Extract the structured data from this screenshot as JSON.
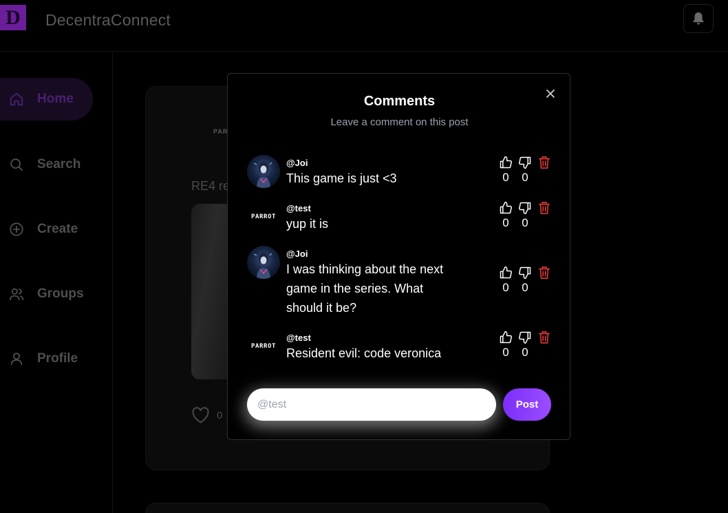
{
  "app": {
    "logo_letter": "D",
    "title": "DecentraConnect",
    "accent_color": "#7b2ff7"
  },
  "sidebar": {
    "items": [
      {
        "label": "Home",
        "icon": "home-icon",
        "active": true
      },
      {
        "label": "Search",
        "icon": "search-icon",
        "active": false
      },
      {
        "label": "Create",
        "icon": "plus-circle-icon",
        "active": false
      },
      {
        "label": "Groups",
        "icon": "users-icon",
        "active": false
      },
      {
        "label": "Profile",
        "icon": "user-icon",
        "active": false
      }
    ]
  },
  "feed": {
    "post_brand": "PARR",
    "post_title": "RE4 re",
    "like_count": "0"
  },
  "modal": {
    "title": "Comments",
    "subtitle": "Leave a comment on this post",
    "comments": [
      {
        "user": "@Joi",
        "text": "This game is just <3",
        "likes": "0",
        "dislikes": "0",
        "avatar": "joi"
      },
      {
        "user": "@test",
        "text": "yup it is",
        "likes": "0",
        "dislikes": "0",
        "avatar": "parrot",
        "avatar_text": "PARROT"
      },
      {
        "user": "@Joi",
        "text": "I was thinking about the next game in the series. What should it be?",
        "likes": "0",
        "dislikes": "0",
        "avatar": "joi"
      },
      {
        "user": "@test",
        "text": "Resident evil: code veronica",
        "likes": "0",
        "dislikes": "0",
        "avatar": "parrot",
        "avatar_text": "PARROT"
      }
    ],
    "input_placeholder": "@test",
    "input_value": "",
    "post_label": "Post",
    "delete_color": "#e53935"
  }
}
